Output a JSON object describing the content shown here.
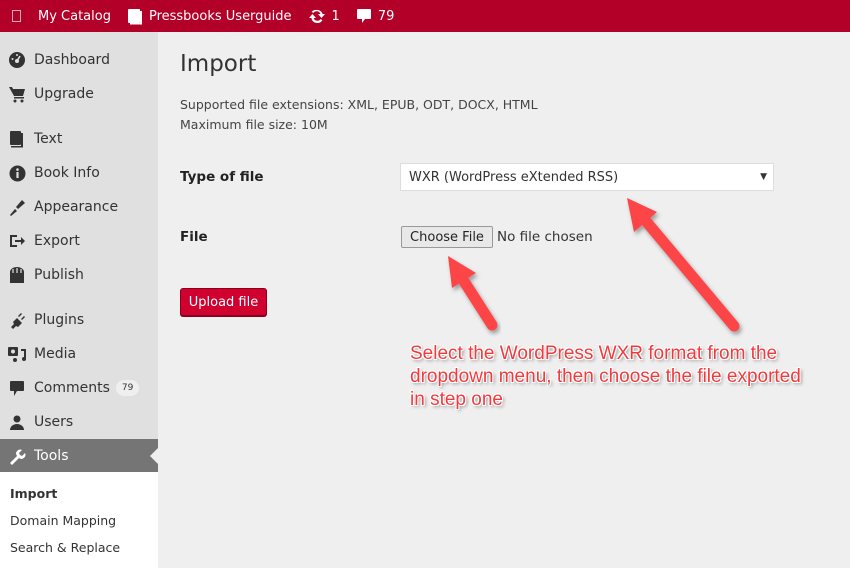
{
  "adminbar": {
    "logo_icon": "wordpress-logo-icon",
    "catalog_label": "My Catalog",
    "site_icon": "book-icon",
    "site_label": "Pressbooks Userguide",
    "updates_icon": "updates-icon",
    "updates_count": "1",
    "comments_icon": "comment-icon",
    "comments_count": "79"
  },
  "sidebar": {
    "items": [
      {
        "label": "Dashboard",
        "icon": "dashboard-icon"
      },
      {
        "label": "Upgrade",
        "icon": "cart-icon"
      },
      {
        "label": "Text",
        "icon": "book-icon"
      },
      {
        "label": "Book Info",
        "icon": "info-icon"
      },
      {
        "label": "Appearance",
        "icon": "paintbrush-icon"
      },
      {
        "label": "Export",
        "icon": "export-icon"
      },
      {
        "label": "Publish",
        "icon": "store-icon"
      },
      {
        "label": "Plugins",
        "icon": "plugin-icon"
      },
      {
        "label": "Media",
        "icon": "media-icon"
      },
      {
        "label": "Comments",
        "icon": "comment-icon",
        "badge": "79"
      },
      {
        "label": "Users",
        "icon": "users-icon"
      },
      {
        "label": "Tools",
        "icon": "wrench-icon",
        "current": true
      }
    ],
    "submenu": [
      {
        "label": "Import",
        "active": true
      },
      {
        "label": "Domain Mapping"
      },
      {
        "label": "Search & Replace"
      }
    ]
  },
  "main": {
    "title": "Import",
    "supported_extensions": "Supported file extensions: XML, EPUB, ODT, DOCX, HTML",
    "max_file_size": "Maximum file size: 10M",
    "type_label": "Type of file",
    "type_selected": "WXR (WordPress eXtended RSS)",
    "file_label": "File",
    "choose_file_label": "Choose File",
    "no_file_text": "No file chosen",
    "upload_label": "Upload file"
  },
  "annotation": {
    "text": "Select the WordPress WXR format from the dropdown menu, then choose the file exported in step one",
    "color": "#f23a3d"
  },
  "colors": {
    "adminbar": "#b30028",
    "primary_button": "#d0002f",
    "sidebar_bg": "#e0e0e0",
    "current_menu_bg": "#757575"
  }
}
